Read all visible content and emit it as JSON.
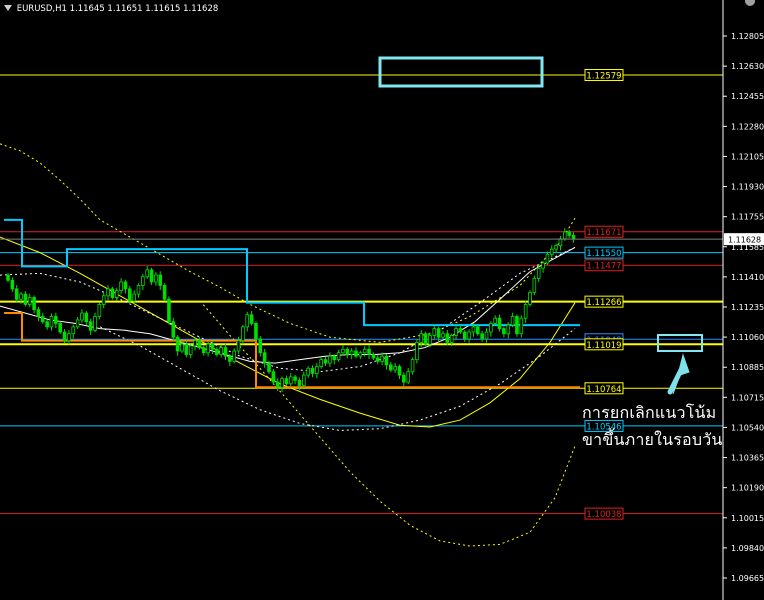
{
  "header": {
    "symbol_timeframe": "EURUSD,H1",
    "ohlc": "1.11645 1.11651 1.11615 1.11628"
  },
  "annotation": {
    "line1": "การยกเลิกแนวโน้ม",
    "line2": "ขาขึ้นภายในรอบวัน",
    "color": "#ffffff",
    "arrow_color": "#7fe0ee"
  },
  "colors": {
    "background": "#000000",
    "candle": "#00dd00",
    "axis": "#ffffff",
    "cyan": "#00ccff",
    "yellow": "#ffff00",
    "red": "#dd2222",
    "orange": "#ff8800",
    "blue": "#2a8cff",
    "box": "#7fe8f0"
  },
  "icons": [
    "dropdown-triangle-icon",
    "window-control-icon"
  ],
  "chart_data": {
    "type": "candlestick",
    "symbol": "EURUSD",
    "timeframe": "H1",
    "ylim": [
      1.0955,
      1.1294
    ],
    "y_ticks": [
      "1.12805",
      "1.12630",
      "1.12455",
      "1.12280",
      "1.12105",
      "1.11930",
      "1.11755",
      "1.11585",
      "1.11410",
      "1.11235",
      "1.11060",
      "1.10885",
      "1.10715",
      "1.10540",
      "1.10365",
      "1.10190",
      "1.10015",
      "1.09840",
      "1.09665"
    ],
    "current_price": "1.11628",
    "horizontal_levels": [
      {
        "price": 1.12579,
        "label": "1.12579",
        "color": "#ffff00",
        "bold": false
      },
      {
        "price": 1.11671,
        "label": "1.11671",
        "color": "#dd2222",
        "bold": false
      },
      {
        "price": 1.1155,
        "label": "1.11550",
        "color": "#00ccff",
        "bold": false
      },
      {
        "price": 1.11477,
        "label": "1.11477",
        "color": "#dd2222",
        "bold": false
      },
      {
        "price": 1.11266,
        "label": "1.11266",
        "color": "#ffff00",
        "bold": true
      },
      {
        "price": 1.11048,
        "label": "1.11048",
        "color": "#2a8cff",
        "bold": false
      },
      {
        "price": 1.11019,
        "label": "1.11019",
        "color": "#ffff00",
        "bold": true
      },
      {
        "price": 1.10764,
        "label": "1.10764",
        "color": "#ffff00",
        "bold": false
      },
      {
        "price": 1.10546,
        "label": "1.10546",
        "color": "#00ccff",
        "bold": false
      },
      {
        "price": 1.10038,
        "label": "1.10038",
        "color": "#dd2222",
        "bold": false
      }
    ],
    "bars_close": [
      1.1139,
      1.1134,
      1.1128,
      1.1131,
      1.1125,
      1.1129,
      1.1122,
      1.1118,
      1.1115,
      1.1112,
      1.1118,
      1.1114,
      1.1109,
      1.1104,
      1.1108,
      1.1112,
      1.1116,
      1.112,
      1.1115,
      1.111,
      1.1118,
      1.1125,
      1.113,
      1.1134,
      1.1129,
      1.1133,
      1.1138,
      1.1134,
      1.1127,
      1.1131,
      1.1136,
      1.1141,
      1.1145,
      1.1138,
      1.1142,
      1.1136,
      1.1128,
      1.1115,
      1.1106,
      1.1098,
      1.1102,
      1.1096,
      1.1101,
      1.1104,
      1.11,
      1.1097,
      1.1102,
      1.1099,
      1.1096,
      1.11,
      1.1095,
      1.1092,
      1.1098,
      1.1104,
      1.1112,
      1.1119,
      1.1114,
      1.1105,
      1.1097,
      1.1091,
      1.1086,
      1.108,
      1.1077,
      1.1082,
      1.1079,
      1.1083,
      1.1081,
      1.1078,
      1.1084,
      1.1088,
      1.1085,
      1.1089,
      1.1093,
      1.1091,
      1.1095,
      1.1093,
      1.1097,
      1.1099,
      1.1096,
      1.1098,
      1.1095,
      1.1097,
      1.1099,
      1.1096,
      1.1094,
      1.1092,
      1.1095,
      1.109,
      1.1087,
      1.1089,
      1.1084,
      1.108,
      1.1086,
      1.1093,
      1.1103,
      1.1108,
      1.1102,
      1.1107,
      1.1111,
      1.1106,
      1.1108,
      1.1103,
      1.1107,
      1.1111,
      1.1109,
      1.1105,
      1.1109,
      1.1112,
      1.1108,
      1.1105,
      1.1109,
      1.1114,
      1.1117,
      1.1111,
      1.1108,
      1.1113,
      1.1118,
      1.1108,
      1.1117,
      1.1125,
      1.1132,
      1.114,
      1.1146,
      1.1149,
      1.1154,
      1.1157,
      1.1159,
      1.1163,
      1.1167,
      1.1165,
      1.1163
    ],
    "series": [
      {
        "name": "",
        "kind": "bollinger-upper",
        "color": "#ffff00",
        "style": "dashed",
        "values": [
          1.1218,
          1.1214,
          1.1207,
          1.1197,
          1.1186,
          1.1174,
          1.1164,
          1.1154,
          1.1144,
          1.1135,
          1.1125,
          1.1114,
          1.1106,
          1.1103,
          1.1108,
          1.1118,
          1.1136,
          1.1161,
          1.1175
        ]
      },
      {
        "name": "",
        "kind": "bollinger-lower",
        "color": "#ffff00",
        "style": "dashed",
        "values": [
          1.1127,
          1.1107,
          1.1088,
          1.1068,
          1.1048,
          1.1028,
          1.1011,
          1.0997,
          1.0988,
          1.0985,
          1.0986,
          1.0993,
          1.1013,
          1.1043
        ]
      },
      {
        "name": "",
        "kind": "moving-average",
        "color": "#ffff00",
        "style": "solid",
        "values": [
          1.1164,
          1.1155,
          1.1143,
          1.113,
          1.1117,
          1.1104,
          1.1091,
          1.1079,
          1.107,
          1.1062,
          1.1055,
          1.1054,
          1.1058,
          1.1068,
          1.1082,
          1.1103,
          1.1126
        ]
      },
      {
        "name": "",
        "kind": "envelope-upper",
        "color": "#ffffff",
        "style": "dashed",
        "values": [
          1.1142,
          1.1143,
          1.1138,
          1.1128,
          1.1117,
          1.1106,
          1.1095,
          1.1088,
          1.1086,
          1.1089,
          1.1097,
          1.111,
          1.1126,
          1.1143,
          1.1158
        ]
      },
      {
        "name": "",
        "kind": "envelope-lower",
        "color": "#ffffff",
        "style": "dashed",
        "values": [
          1.1112,
          1.1101,
          1.1088,
          1.1075,
          1.1064,
          1.1056,
          1.1052,
          1.1053,
          1.1058,
          1.1066,
          1.1079,
          1.1095,
          1.1111
        ]
      },
      {
        "name": "",
        "kind": "white-ma",
        "color": "#ffffff",
        "style": "solid",
        "values": [
          1.1124,
          1.112,
          1.1116,
          1.1114,
          1.1111,
          1.111,
          1.1108,
          1.1104,
          1.11,
          1.1096,
          1.1092,
          1.1091,
          1.1093,
          1.1095,
          1.1096,
          1.1096,
          1.1097,
          1.11,
          1.1106,
          1.1115,
          1.1128,
          1.1144,
          1.1158
        ]
      },
      {
        "name": "",
        "kind": "channel-high",
        "color": "#00ccff",
        "style": "step",
        "values": [
          1.1174,
          1.1174,
          1.1147,
          1.1147,
          1.1147,
          1.1147,
          1.1147,
          1.1157,
          1.1157,
          1.1157,
          1.1157,
          1.1157,
          1.1157,
          1.1157,
          1.1157,
          1.1157,
          1.1157,
          1.1157,
          1.1157,
          1.1157,
          1.1157,
          1.1157,
          1.1157,
          1.1157,
          1.1157,
          1.1157,
          1.1157,
          1.1126,
          1.1126,
          1.1126,
          1.1126,
          1.1126,
          1.1126,
          1.1126,
          1.1126,
          1.1126,
          1.1126,
          1.1126,
          1.1126,
          1.1126,
          1.1113,
          1.1113,
          1.1113,
          1.1113,
          1.1113,
          1.1113,
          1.1113,
          1.1113,
          1.1113,
          1.1113,
          1.1113,
          1.1113,
          1.1113,
          1.1113,
          1.1113,
          1.1113,
          1.1113,
          1.1113,
          1.1113,
          1.1113,
          1.1113,
          1.1113,
          1.1113,
          1.1113
        ]
      },
      {
        "name": "",
        "kind": "channel-low",
        "color": "#ff8800",
        "style": "step",
        "values": [
          1.112,
          1.112,
          1.1104,
          1.1104,
          1.1104,
          1.1104,
          1.1104,
          1.1104,
          1.1104,
          1.1104,
          1.1104,
          1.1104,
          1.1104,
          1.1104,
          1.1104,
          1.1104,
          1.1104,
          1.1104,
          1.1104,
          1.1104,
          1.1104,
          1.1104,
          1.1104,
          1.1104,
          1.1104,
          1.1104,
          1.1104,
          1.1104,
          1.1077,
          1.1077,
          1.1077,
          1.1077,
          1.1077,
          1.1077,
          1.1077,
          1.1077,
          1.1077,
          1.1077,
          1.1077,
          1.1077,
          1.1077,
          1.1077,
          1.1077,
          1.1077,
          1.1077,
          1.1077,
          1.1077,
          1.1077,
          1.1077,
          1.1077,
          1.1077,
          1.1077,
          1.1077,
          1.1077,
          1.1077,
          1.1077,
          1.1077,
          1.1077,
          1.1077,
          1.1077,
          1.1077,
          1.1077,
          1.1077,
          1.1077
        ]
      }
    ]
  }
}
